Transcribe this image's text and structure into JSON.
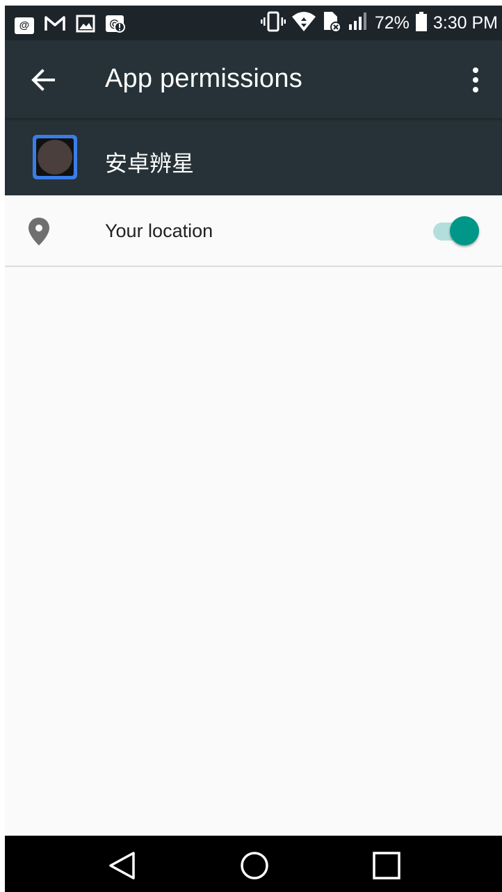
{
  "status_bar": {
    "notification_icons": [
      "at-sign-icon",
      "gmail-icon",
      "image-icon",
      "at-alert-icon"
    ],
    "at_symbol": "@",
    "system_icons": [
      "vibrate-icon",
      "wifi-icon",
      "sim-error-icon",
      "signal-icon",
      "battery-icon"
    ],
    "battery": "72%",
    "time": "3:30 PM"
  },
  "toolbar": {
    "title": "App permissions",
    "back_icon": "arrow-back-icon",
    "menu_icon": "more-vert-icon"
  },
  "app": {
    "name": "安卓辨星",
    "icon": "app-icon",
    "accent_color": "#3b7de8"
  },
  "permissions": [
    {
      "label": "Your location",
      "icon": "location-pin-icon",
      "enabled": true
    }
  ],
  "navigation_bar": {
    "buttons": [
      "back-triangle-icon",
      "home-circle-icon",
      "recents-square-icon"
    ]
  },
  "colors": {
    "toolbar": "#263238",
    "status_bar": "#1d252b",
    "switch_thumb": "#009688",
    "switch_track": "#b2dfdb",
    "background": "#fafafa"
  }
}
